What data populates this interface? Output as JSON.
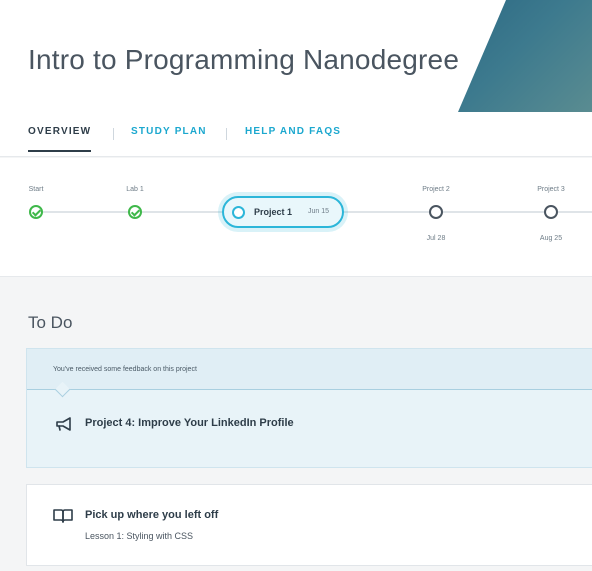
{
  "header": {
    "title": "Intro to Programming Nanodegree"
  },
  "tabs": [
    {
      "label": "OVERVIEW",
      "active": true
    },
    {
      "label": "STUDY PLAN",
      "active": false
    },
    {
      "label": "HELP AND FAQS",
      "active": false
    }
  ],
  "timeline": {
    "start": {
      "label": "Start",
      "status": "complete"
    },
    "lab1": {
      "label": "Lab 1",
      "status": "complete"
    },
    "current": {
      "label": "Project 1",
      "date": "Jun 15"
    },
    "project2": {
      "label": "Project 2",
      "date": "Jul 28",
      "status": "upcoming"
    },
    "project3": {
      "label": "Project 3",
      "date": "Aug 25",
      "status": "upcoming"
    }
  },
  "todo": {
    "heading": "To Do",
    "feedback": {
      "message": "You've received some feedback on this project",
      "project_title": "Project 4: Improve Your LinkedIn Profile",
      "icon": "megaphone-icon"
    },
    "resume": {
      "title": "Pick up where you left off",
      "subtitle": "Lesson 1: Styling with CSS",
      "icon": "book-icon"
    }
  },
  "colors": {
    "accent": "#1ca8cf",
    "complete": "#3fb84a",
    "text": "#2e3d49"
  }
}
